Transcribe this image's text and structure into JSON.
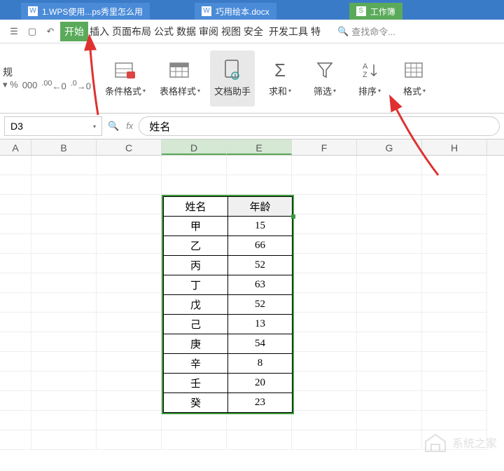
{
  "tabs": [
    {
      "label": "1.WPS使用...ps秀里怎么用",
      "type": "doc"
    },
    {
      "label": "巧用绘本.docx",
      "type": "doc"
    },
    {
      "label": "工作簿",
      "type": "sheet"
    }
  ],
  "nav": {
    "items": [
      "开始",
      "插入",
      "页面布局",
      "公式",
      "数据",
      "审阅",
      "视图",
      "安全",
      "开发工具",
      "特"
    ],
    "active": 0
  },
  "search": {
    "placeholder": "查找命令..."
  },
  "number_format": {
    "label": "规",
    "percent": "%",
    "zeros_a": ".0",
    "zeros_b": ".00",
    "inc": "←0",
    "dec": "→0"
  },
  "ribbon": {
    "cond_format": "条件格式",
    "table_style": "表格样式",
    "doc_helper": "文档助手",
    "sum": "求和",
    "filter": "筛选",
    "sort": "排序",
    "format": "格式"
  },
  "name_box": "D3",
  "fx_label": "fx",
  "formula_value": "姓名",
  "columns": [
    "A",
    "B",
    "C",
    "D",
    "E",
    "F",
    "G",
    "H"
  ],
  "selected_cols": [
    "D",
    "E"
  ],
  "chart_data": {
    "type": "table",
    "headers": [
      "姓名",
      "年龄"
    ],
    "rows": [
      {
        "name": "甲",
        "age": 15
      },
      {
        "name": "乙",
        "age": 66
      },
      {
        "name": "丙",
        "age": 52
      },
      {
        "name": "丁",
        "age": 63
      },
      {
        "name": "戊",
        "age": 52
      },
      {
        "name": "己",
        "age": 13
      },
      {
        "name": "庚",
        "age": 54
      },
      {
        "name": "辛",
        "age": 8
      },
      {
        "name": "壬",
        "age": 20
      },
      {
        "name": "癸",
        "age": 23
      }
    ]
  },
  "watermark": "系统之家"
}
